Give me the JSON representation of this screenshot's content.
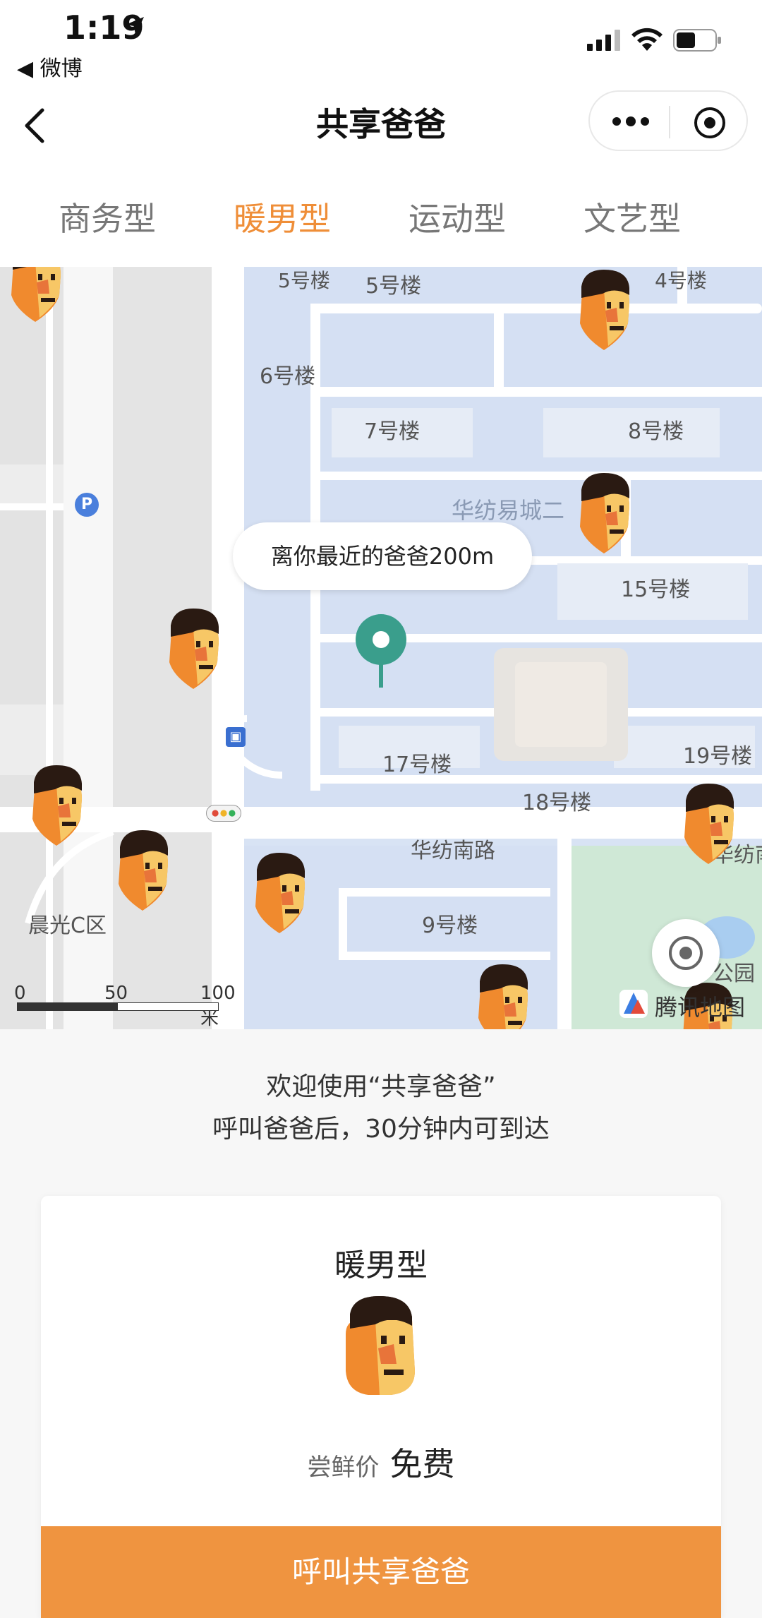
{
  "status_bar": {
    "time": "1:19",
    "back_app": "◀ 微博"
  },
  "nav": {
    "title": "共享爸爸"
  },
  "tabs": [
    {
      "label": "商务型",
      "active": false
    },
    {
      "label": "暖男型",
      "active": true
    },
    {
      "label": "运动型",
      "active": false
    },
    {
      "label": "文艺型",
      "active": false
    }
  ],
  "map": {
    "bubble": "离你最近的爸爸200m",
    "labels": {
      "b5a": "5号楼",
      "b5b": "5号楼",
      "b4": "4号楼",
      "b6": "6号楼",
      "b7": "7号楼",
      "b8": "8号楼",
      "huafang2": "华纺易城二",
      "b15": "15号楼",
      "b17": "17号楼",
      "b19": "19号楼",
      "b18": "18号楼",
      "road": "华纺南路",
      "road2": "华纺南",
      "chenguang": "晨光C区",
      "b9": "9号楼",
      "park": "公园"
    },
    "scale": {
      "s0": "0",
      "s50": "50",
      "s100": "100 米"
    },
    "provider": "腾讯地图"
  },
  "welcome": {
    "line1": "欢迎使用“共享爸爸”",
    "line2": "呼叫爸爸后，30分钟内可到达"
  },
  "card": {
    "type": "暖男型",
    "price_label": "尝鲜价",
    "price_value": "免费",
    "button": "呼叫共享爸爸"
  },
  "colors": {
    "accent": "#ef9440",
    "active_tab": "#ef8e38",
    "pin": "#3a9e8c"
  }
}
